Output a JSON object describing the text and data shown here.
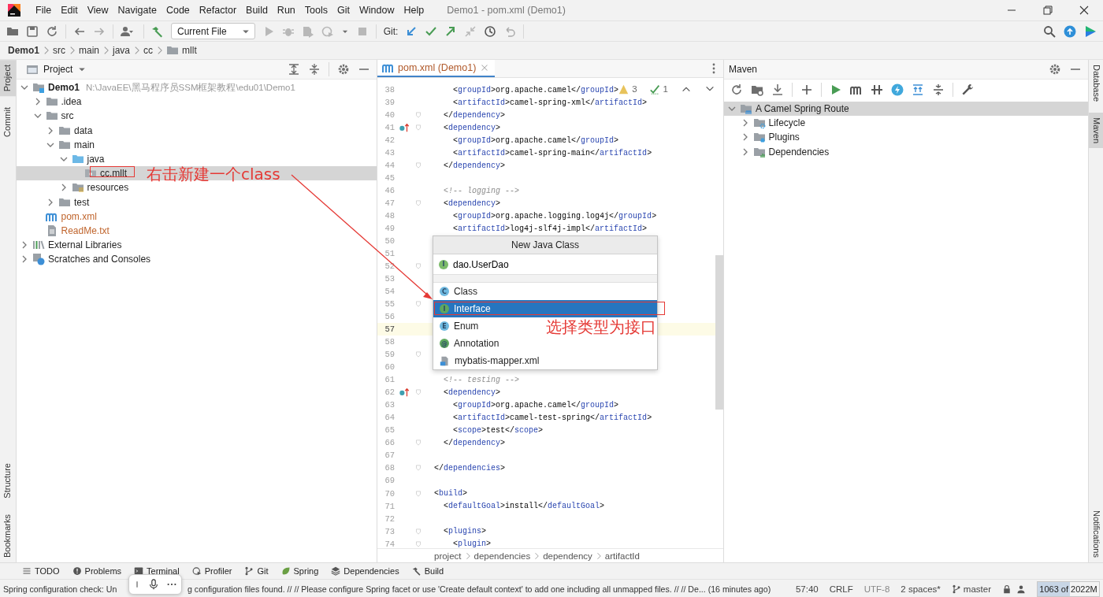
{
  "title_bar": {
    "menu": [
      "File",
      "Edit",
      "View",
      "Navigate",
      "Code",
      "Refactor",
      "Build",
      "Run",
      "Tools",
      "Git",
      "Window",
      "Help"
    ],
    "title": "Demo1 - pom.xml (Demo1)"
  },
  "toolbar": {
    "run_config": "Current File",
    "git_label": "Git:"
  },
  "breadcrumb": [
    "Demo1",
    "src",
    "main",
    "java",
    "cc",
    "mllt"
  ],
  "left_strip": {
    "top": [
      {
        "label": "Project",
        "selected": true
      },
      {
        "label": "Commit",
        "selected": false
      }
    ],
    "bottom": [
      {
        "label": "Structure",
        "selected": false
      },
      {
        "label": "Bookmarks",
        "selected": false
      }
    ]
  },
  "project_panel": {
    "title": "Project",
    "tree": [
      {
        "label": "Demo1",
        "path": "N:\\JavaEE\\黑马程序员SSM框架教程\\edu01\\Demo1",
        "kind": "module",
        "expanded": true,
        "selected": false,
        "children": [
          {
            "label": ".idea",
            "kind": "folder",
            "expanded": false,
            "selected": false
          },
          {
            "label": "src",
            "kind": "folder",
            "expanded": true,
            "selected": false,
            "children": [
              {
                "label": "data",
                "kind": "folder",
                "expanded": false,
                "selected": false
              },
              {
                "label": "main",
                "kind": "folder",
                "expanded": true,
                "selected": false,
                "children": [
                  {
                    "label": "java",
                    "kind": "source",
                    "expanded": true,
                    "selected": false,
                    "children": [
                      {
                        "label": "cc.mllt",
                        "kind": "package",
                        "selected": true
                      }
                    ]
                  },
                  {
                    "label": "resources",
                    "kind": "resources",
                    "expanded": false,
                    "selected": false
                  }
                ]
              },
              {
                "label": "test",
                "kind": "folder",
                "expanded": false,
                "selected": false
              }
            ]
          },
          {
            "label": "pom.xml",
            "kind": "maven",
            "selected": false,
            "color": "#c0652d"
          },
          {
            "label": "ReadMe.txt",
            "kind": "text",
            "selected": false,
            "color": "#c0652d"
          }
        ]
      },
      {
        "label": "External Libraries",
        "kind": "libraries",
        "expanded": false,
        "selected": false
      },
      {
        "label": "Scratches and Consoles",
        "kind": "scratches",
        "expanded": false,
        "selected": false
      }
    ]
  },
  "editor": {
    "tab": {
      "label": "pom.xml (Demo1)",
      "selected": true
    },
    "inspections": {
      "warnings": "3",
      "checks": "1"
    },
    "lines": [
      {
        "n": "38",
        "text": "      <groupId>org.apache.camel</groupId>",
        "fold": false,
        "marker": false,
        "current": false
      },
      {
        "n": "39",
        "text": "      <artifactId>camel-spring-xml</artifactId>",
        "fold": false,
        "marker": false,
        "current": false
      },
      {
        "n": "40",
        "text": "    </dependency>",
        "fold": true,
        "marker": false,
        "current": false
      },
      {
        "n": "41",
        "text": "    <dependency>",
        "fold": true,
        "marker": true,
        "current": false
      },
      {
        "n": "42",
        "text": "      <groupId>org.apache.camel</groupId>",
        "fold": false,
        "marker": false,
        "current": false
      },
      {
        "n": "43",
        "text": "      <artifactId>camel-spring-main</artifactId>",
        "fold": false,
        "marker": false,
        "current": false
      },
      {
        "n": "44",
        "text": "    </dependency>",
        "fold": true,
        "marker": false,
        "current": false
      },
      {
        "n": "45",
        "fold": false,
        "marker": false,
        "current": false
      },
      {
        "n": "46",
        "text": "    <!-- logging -->",
        "kind": "comment",
        "fold": false,
        "marker": false,
        "current": false
      },
      {
        "n": "47",
        "text": "    <dependency>",
        "fold": true,
        "marker": false,
        "current": false
      },
      {
        "n": "48",
        "text": "      <groupId>org.apache.logging.log4j</groupId>",
        "fold": false,
        "marker": false,
        "current": false
      },
      {
        "n": "49",
        "text": "      <artifactId>log4j-slf4j-impl</artifactId>",
        "fold": false,
        "marker": false,
        "current": false
      },
      {
        "n": "50",
        "fold": false,
        "marker": false,
        "current": false
      },
      {
        "n": "51",
        "fold": false,
        "marker": false,
        "current": false
      },
      {
        "n": "52",
        "fold": true,
        "marker": false,
        "current": false
      },
      {
        "n": "53",
        "fold": false,
        "marker": false,
        "current": false
      },
      {
        "n": "54",
        "fold": false,
        "marker": false,
        "current": false
      },
      {
        "n": "55",
        "fold": true,
        "marker": false,
        "current": false
      },
      {
        "n": "56",
        "fold": false,
        "marker": false,
        "current": false
      },
      {
        "n": "57",
        "fold": false,
        "marker": false,
        "current": true
      },
      {
        "n": "58",
        "fold": false,
        "marker": false,
        "current": false
      },
      {
        "n": "59",
        "fold": true,
        "marker": false,
        "current": false
      },
      {
        "n": "60",
        "fold": false,
        "marker": false,
        "current": false
      },
      {
        "n": "61",
        "text": "    <!-- testing -->",
        "kind": "comment",
        "fold": false,
        "marker": false,
        "current": false
      },
      {
        "n": "62",
        "text": "    <dependency>",
        "fold": true,
        "marker": true,
        "current": false
      },
      {
        "n": "63",
        "text": "      <groupId>org.apache.camel</groupId>",
        "fold": false,
        "marker": false,
        "current": false
      },
      {
        "n": "64",
        "text": "      <artifactId>camel-test-spring</artifactId>",
        "fold": false,
        "marker": false,
        "current": false
      },
      {
        "n": "65",
        "text": "      <scope>test</scope>",
        "fold": false,
        "marker": false,
        "current": false
      },
      {
        "n": "66",
        "text": "    </dependency>",
        "fold": true,
        "marker": false,
        "current": false
      },
      {
        "n": "67",
        "fold": false,
        "marker": false,
        "current": false
      },
      {
        "n": "68",
        "text": "  </dependencies>",
        "fold": true,
        "marker": false,
        "current": false
      },
      {
        "n": "69",
        "fold": false,
        "marker": false,
        "current": false
      },
      {
        "n": "70",
        "text": "  <build>",
        "fold": true,
        "marker": false,
        "current": false
      },
      {
        "n": "71",
        "text": "    <defaultGoal>install</defaultGoal>",
        "fold": false,
        "marker": false,
        "current": false
      },
      {
        "n": "72",
        "fold": false,
        "marker": false,
        "current": false
      },
      {
        "n": "73",
        "text": "    <plugins>",
        "fold": true,
        "marker": false,
        "current": false
      },
      {
        "n": "74",
        "text": "      <plugin>",
        "fold": true,
        "marker": false,
        "current": false
      }
    ],
    "breadcrumb": [
      "project",
      "dependencies",
      "dependency",
      "artifactId"
    ]
  },
  "popup": {
    "title": "New Java Class",
    "input": {
      "icon": "I",
      "value": "dao.UserDao"
    },
    "items": [
      {
        "kind": "class",
        "icon": "C",
        "label": "Class",
        "selected": false
      },
      {
        "kind": "interface",
        "icon": "I",
        "label": "Interface",
        "selected": true
      },
      {
        "kind": "enum",
        "icon": "E",
        "label": "Enum",
        "selected": false
      },
      {
        "kind": "annotation",
        "icon": "@",
        "label": "Annotation",
        "selected": false
      },
      {
        "kind": "file",
        "label": "mybatis-mapper.xml",
        "selected": false
      }
    ]
  },
  "maven_panel": {
    "title": "Maven",
    "tree": [
      {
        "label": "A Camel Spring Route",
        "kind": "maven-project",
        "expanded": true,
        "selected": true,
        "children": [
          {
            "label": "Lifecycle",
            "kind": "lifecycle",
            "expanded": false,
            "selected": false
          },
          {
            "label": "Plugins",
            "kind": "plugins",
            "expanded": false,
            "selected": false
          },
          {
            "label": "Dependencies",
            "kind": "dependencies",
            "expanded": false,
            "selected": false
          }
        ]
      }
    ]
  },
  "right_strip": {
    "top": [
      {
        "label": "Database",
        "selected": false
      },
      {
        "label": "Maven",
        "selected": true
      }
    ],
    "bottom": [
      {
        "label": "Notifications",
        "selected": false
      }
    ]
  },
  "tool_tabs": [
    {
      "kind": "todo",
      "label": "TODO"
    },
    {
      "kind": "problems",
      "label": "Problems"
    },
    {
      "kind": "terminal",
      "label": "Terminal"
    },
    {
      "kind": "profiler",
      "label": "Profiler"
    },
    {
      "kind": "git",
      "label": "Git"
    },
    {
      "kind": "spring",
      "label": "Spring"
    },
    {
      "kind": "dependencies",
      "label": "Dependencies"
    },
    {
      "kind": "build",
      "label": "Build"
    }
  ],
  "status_bar": {
    "message_parts": [
      "Spring configuration check: Un",
      "g configuration files found. // // Please configure Spring facet or use 'Create default context' to add one including all unmapped files. // // De... (16 minutes ago)"
    ],
    "position": "57:40",
    "line_separator": "CRLF",
    "encoding": "UTF-8",
    "indent": "2 spaces*",
    "branch": "master",
    "memory": {
      "text": "1063 of 2022M",
      "level": 0.526
    }
  },
  "annotations": [
    "右击新建一个class",
    "选择类型为接口"
  ]
}
